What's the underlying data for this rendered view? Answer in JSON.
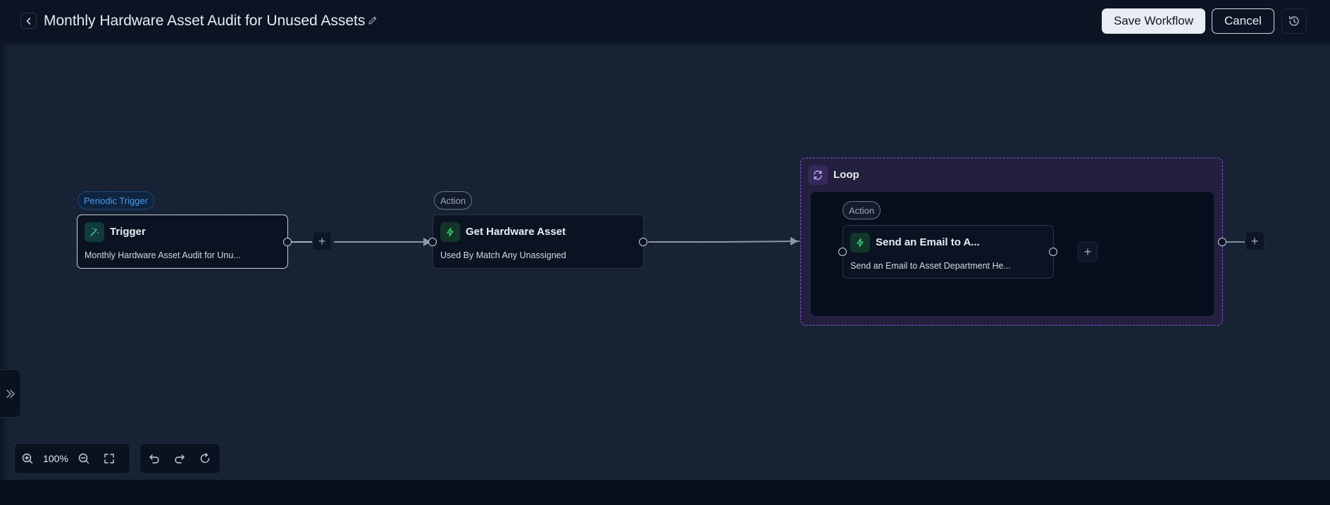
{
  "header": {
    "title": "Monthly Hardware Asset Audit for Unused Assets",
    "save_label": "Save Workflow",
    "cancel_label": "Cancel"
  },
  "workflow": {
    "trigger": {
      "badge": "Periodic Trigger",
      "title": "Trigger",
      "subtitle": "Monthly Hardware Asset Audit for Unu..."
    },
    "action1": {
      "badge": "Action",
      "title": "Get Hardware Asset",
      "subtitle": "Used By Match Any Unassigned"
    },
    "loop": {
      "label": "Loop",
      "action": {
        "badge": "Action",
        "title": "Send an Email to A...",
        "subtitle": "Send an Email to Asset Department He..."
      }
    }
  },
  "toolbar": {
    "zoom_level": "100%"
  },
  "icons": {
    "back": "chevron-left-icon",
    "edit": "pencil-icon",
    "history": "history-icon",
    "trigger": "sparkle-icon",
    "action": "lightning-icon",
    "loop": "refresh-icon",
    "zoom_in": "zoom-in-icon",
    "zoom_out": "zoom-out-icon",
    "fit": "fit-screen-icon",
    "undo": "undo-icon",
    "redo": "redo-icon",
    "reset": "reset-icon",
    "side_toggle": "double-chevron-right-icon"
  },
  "colors": {
    "canvas": "#172235",
    "trigger_badge": "#4a9be9",
    "action_icon": "#3ed17f",
    "trigger_icon": "#3fd0b4",
    "loop_border": "#8a55d6"
  }
}
